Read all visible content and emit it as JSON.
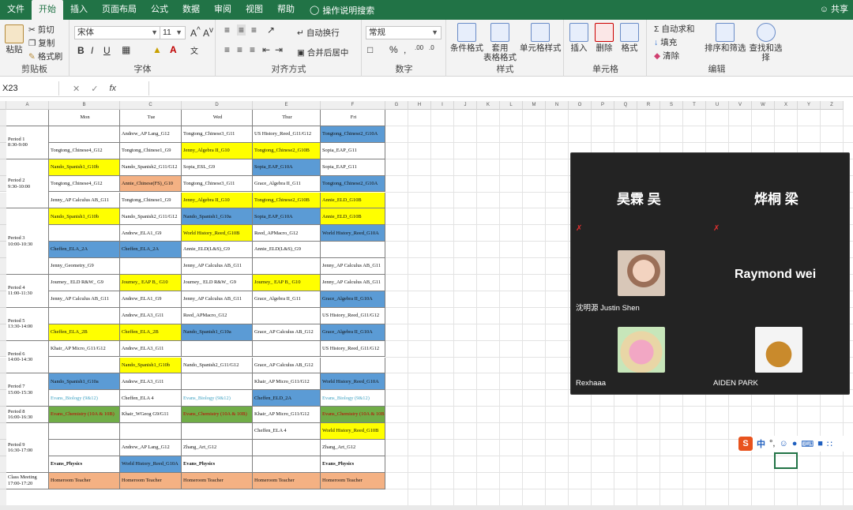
{
  "ribbon_tabs": [
    "文件",
    "开始",
    "插入",
    "页面布局",
    "公式",
    "数据",
    "审阅",
    "视图",
    "帮助"
  ],
  "active_tab": "开始",
  "tell_me": "操作说明搜索",
  "share": "共享",
  "clipboard": {
    "paste": "粘贴",
    "cut": "剪切",
    "copy": "复制",
    "format_painter": "格式刷",
    "label": "剪贴板"
  },
  "font": {
    "name": "宋体",
    "size": "11",
    "label": "字体",
    "bold": "B",
    "italic": "I",
    "underline": "U"
  },
  "alignment": {
    "wrap": "自动换行",
    "merge": "合并后居中",
    "label": "对齐方式"
  },
  "number": {
    "format": "常规",
    "label": "数字",
    "percent": "%",
    "comma": ","
  },
  "styles": {
    "conditional": "条件格式",
    "table": "套用\n表格格式",
    "cell_style": "单元格样式",
    "label": "样式"
  },
  "cells": {
    "insert": "插入",
    "delete": "删除",
    "format": "格式",
    "label": "单元格"
  },
  "editing": {
    "autosum": "自动求和",
    "fill": "填充",
    "clear": "清除",
    "sort": "排序和筛选",
    "find": "查找和选择",
    "label": "编辑"
  },
  "namebox": "X23",
  "fx": "fx",
  "columns": [
    "A",
    "B",
    "C",
    "D",
    "E",
    "F",
    "G",
    "H",
    "I",
    "J",
    "K",
    "L",
    "M",
    "N",
    "O",
    "P",
    "Q",
    "R",
    "S",
    "T",
    "U",
    "V",
    "W",
    "X",
    "Y",
    "Z"
  ],
  "days": [
    "Mon",
    "Tue",
    "Wed",
    "Thur",
    "Fri"
  ],
  "periods": [
    {
      "label": "Period 1\n8:30-9:00",
      "rows": 2
    },
    {
      "label": "Period 2\n9:30-10:00",
      "rows": 3
    },
    {
      "label": "Period 3\n10:00-10:30",
      "rows": 4
    },
    {
      "label": "Period 4\n11:00-11:30",
      "rows": 2
    },
    {
      "label": "Period 5\n13:30-14:00",
      "rows": 2
    },
    {
      "label": "Period 6\n14:00-14:30",
      "rows": 2
    },
    {
      "label": "Period 7\n15:00-15:30",
      "rows": 2
    },
    {
      "label": "Period 8\n16:00-16:30",
      "rows": 1
    },
    {
      "label": "Period 9\n16:30-17:00",
      "rows": 3
    },
    {
      "label": "Class Meeting\n17:00-17:20",
      "rows": 1
    }
  ],
  "schedule": [
    [
      [
        "",
        ""
      ],
      [
        "Andrew_AP Lang_G12",
        ""
      ],
      [
        "Tongtong_Chinese3_G11",
        ""
      ],
      [
        "US History_Reed_G11/G12",
        ""
      ],
      [
        "Tongtong_Chinese2_G10A",
        "b"
      ]
    ],
    [
      [
        "Tongtong_Chinese4_G12",
        ""
      ],
      [
        "Tongtong_Chinese1_G9",
        ""
      ],
      [
        "Jenny_Algebra II_G10",
        "y"
      ],
      [
        "Tongtong_Chinese2_G10B",
        "y"
      ],
      [
        "Sopia_EAP_G11",
        ""
      ]
    ],
    [
      [
        "Nando_Spanish1_G10b",
        "y"
      ],
      [
        "Nando_Spanish2_G11/G12",
        ""
      ],
      [
        "Sopia_ESL_G9",
        ""
      ],
      [
        "Sopia_EAP_G10A",
        "b"
      ],
      [
        "Sopia_EAP_G11",
        ""
      ]
    ],
    [
      [
        "Tongtong_Chinese4_G12",
        ""
      ],
      [
        "Annie_Chinese(FS)_G10",
        "o"
      ],
      [
        "Tongtong_Chinese3_G11",
        ""
      ],
      [
        "Grace_Algebra II_G11",
        ""
      ],
      [
        "Tongtong_Chinese2_G10A",
        "b"
      ]
    ],
    [
      [
        "Jenny_AP Calculus AB_G11",
        ""
      ],
      [
        "Tongtong_Chinese1_G9",
        ""
      ],
      [
        "Jenny_Algebra II_G10",
        "y"
      ],
      [
        "Tongtong_Chinese2_G10B",
        "y"
      ],
      [
        "Annie_ELD_G10B",
        "y"
      ]
    ],
    [
      [
        "Nando_Spanish1_G10b",
        "y"
      ],
      [
        "Nando_Spanish2_G11/G12",
        ""
      ],
      [
        "Nando_Spanish1_G10a",
        "b"
      ],
      [
        "Sopia_EAP_G10A",
        "b"
      ],
      [
        "Annie_ELD_G10B",
        "y"
      ]
    ],
    [
      [
        "",
        ""
      ],
      [
        "Andrew_ELA1_G9",
        ""
      ],
      [
        "World History_Reed_G10B",
        "y"
      ],
      [
        "Reed_APMacro_G12",
        ""
      ],
      [
        "World History_Reed_G10A",
        "b"
      ]
    ],
    [
      [
        "Cheffen_ELA_2A",
        "b"
      ],
      [
        "Cheffen_ELA_2A",
        "b"
      ],
      [
        "Annie_ELD(L&S)_G9",
        ""
      ],
      [
        "Annie_ELD(L&S)_G9",
        ""
      ],
      [
        "",
        ""
      ]
    ],
    [
      [
        "Jenny_Geometry_G9",
        ""
      ],
      [
        "",
        ""
      ],
      [
        "Jenny_AP Calculus AB_G11",
        ""
      ],
      [
        "",
        ""
      ],
      [
        "Jenny_AP Calculus AB_G11",
        ""
      ]
    ],
    [
      [
        "Journey_ ELD R&W_ G9",
        ""
      ],
      [
        "Journey_ EAP B_ G10",
        "y"
      ],
      [
        "Journey_ ELD R&W_ G9",
        ""
      ],
      [
        "Journey_ EAP B_ G10",
        "y"
      ],
      [
        "Jenny_AP Calculus AB_G11",
        ""
      ]
    ],
    [
      [
        "Jenny_AP Calculus AB_G11",
        ""
      ],
      [
        "Andrew_ELA1_G9",
        ""
      ],
      [
        "Jenny_AP Calculus AB_G11",
        ""
      ],
      [
        "Grace_Algebra II_G11",
        ""
      ],
      [
        "Grace_Algebra II_G10A",
        "b"
      ]
    ],
    [
      [
        "",
        ""
      ],
      [
        "Andrew_ELA3_G11",
        ""
      ],
      [
        "Reed_APMacro_G12",
        ""
      ],
      [
        "",
        ""
      ],
      [
        "US History_Reed_G11/G12",
        ""
      ]
    ],
    [
      [
        "Cheffen_ELA_2B",
        "y"
      ],
      [
        "Cheffen_ELA_2B",
        "y"
      ],
      [
        "Nando_Spanish1_G10a",
        "b"
      ],
      [
        "Grace_AP Calculus AB_G12",
        ""
      ],
      [
        "Grace_Algebra II_G10A",
        "b"
      ]
    ],
    [
      [
        "Khair_AP Micro_G11/G12",
        ""
      ],
      [
        "Andrew_ELA3_G11",
        ""
      ],
      [
        "",
        ""
      ],
      [
        "",
        ""
      ],
      [
        "US History_Reed_G11/G12",
        ""
      ]
    ],
    [
      [
        "",
        ""
      ],
      [
        "Nando_Spanish1_G10b",
        "y"
      ],
      [
        "Nando_Spanish2_G11/G12",
        ""
      ],
      [
        "Grace_AP Calculus AB_G12",
        ""
      ],
      [
        "",
        ""
      ]
    ],
    [
      [
        "Nando_Spanish1_G10a",
        "b"
      ],
      [
        "Andrew_ELA3_G11",
        ""
      ],
      [
        "",
        ""
      ],
      [
        "Khair_AP Micro_G11/G12",
        ""
      ],
      [
        "World History_Reed_G10A",
        "b"
      ]
    ],
    [
      [
        "Evans_Biology (9&12)",
        "ltblue"
      ],
      [
        "Cheffen_ELA 4",
        ""
      ],
      [
        "Evans_Biology (9&12)",
        "ltblue"
      ],
      [
        "Cheffen_ELD_2A",
        "b"
      ],
      [
        "Evans_Biology (9&12)",
        "ltblue"
      ]
    ],
    [
      [
        "Evans_Chemistry (10A & 10B)",
        "g red"
      ],
      [
        "Khair_WGeog G9/G11",
        ""
      ],
      [
        "Evans_Chemistry (10A & 10B)",
        "g red"
      ],
      [
        "Khair_AP Micro_G11/G12",
        ""
      ],
      [
        "Evans_Chemistry (10A & 10B)",
        "g red"
      ]
    ],
    [
      [
        "",
        ""
      ],
      [
        "",
        ""
      ],
      [
        "",
        ""
      ],
      [
        "Cheffen_ELA 4",
        ""
      ],
      [
        "World History_Reed_G10B",
        "y"
      ]
    ],
    [
      [
        "",
        ""
      ],
      [
        "Andrew_AP Lang_G12",
        ""
      ],
      [
        "Zhang_Art_G12",
        ""
      ],
      [
        "",
        ""
      ],
      [
        "Zhang_Art_G12",
        ""
      ]
    ],
    [
      [
        "Evans_Physics",
        "bold"
      ],
      [
        "World History_Reed_G10A",
        "b"
      ],
      [
        "Evans_Physics",
        "bold"
      ],
      [
        "",
        ""
      ],
      [
        "Evans_Physics",
        "bold"
      ]
    ],
    [
      [
        "Homeroom Teacher",
        "o"
      ],
      [
        "Homeroom Teacher",
        "o"
      ],
      [
        "Homeroom Teacher",
        "o"
      ],
      [
        "Homeroom Teacher",
        "o"
      ],
      [
        "Homeroom Teacher",
        "o"
      ]
    ]
  ],
  "video_call": {
    "top_left_name": "昊霖 吴",
    "top_right_name": "烨桐 梁",
    "mid_left_label": "沈明源 Justin Shen",
    "mid_right_name": "Raymond wei",
    "bottom_left_label": "Rexhaaa",
    "bottom_right_label": "AIDEN PARK",
    "muted_icon": "muted-mic-icon"
  },
  "ime": {
    "logo": "S",
    "lang": "中",
    "punct": "°,"
  },
  "colors": {
    "excel_green": "#217346",
    "yellow": "#ffff00",
    "blue": "#5b9bd5",
    "orange": "#f4b183",
    "green": "#70ad47"
  }
}
